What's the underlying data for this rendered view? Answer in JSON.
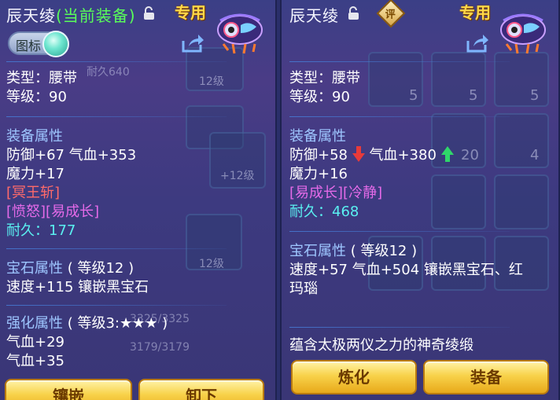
{
  "left": {
    "title_name": "辰天绫",
    "title_current": "(当前装备)",
    "special_tag": "专用",
    "icon_toggle_label": "图标",
    "type_line": "类型：腰带",
    "level_line": "等级：90",
    "attr_header": "装备属性",
    "attr_line1": "防御+67 气血+353",
    "attr_line2": "魔力+17",
    "skill": "[冥王斩]",
    "effects": "[愤怒][易成长]",
    "durability": "耐久：177",
    "gem_header": "宝石属性",
    "gem_level": "( 等级12 )",
    "gem_line": "速度+115 镶嵌黑宝石",
    "enh_header": "强化属性",
    "enh_level": "( 等级3:★★★ )",
    "enh_line1": "气血+29",
    "enh_line2": "气血+35",
    "bg_texts": {
      "durability_bg": "耐久640",
      "level_bg1": "12级",
      "level_bg2": "+12级",
      "level_bg3": "12级",
      "hp_bg1": "3325/3325",
      "hp_bg2": "3179/3179"
    },
    "buttons": [
      "镶嵌",
      "卸下"
    ]
  },
  "right": {
    "title_name": "辰天绫",
    "eval_badge": "评",
    "special_tag": "专用",
    "type_line": "类型：腰带",
    "level_line": "等级：90",
    "attr_header": "装备属性",
    "attr_def": "防御+58",
    "attr_hp": "气血+380",
    "attr_line2": "魔力+16",
    "effects": "[易成长][冷静]",
    "durability": "耐久：468",
    "gem_header": "宝石属性",
    "gem_level": "( 等级12 )",
    "gem_line1": "速度+57 气血+504 镶嵌黑宝石、红",
    "gem_line2": "玛瑙",
    "description": "蕴含太极两仪之力的神奇绫缎",
    "bg_numbers": [
      "5",
      "5",
      "5",
      "20",
      "4"
    ],
    "buttons": [
      "炼化",
      "装备"
    ]
  },
  "colors": {
    "gold": "#ffd84a",
    "green_current": "#59ff59",
    "header_blue": "#9ec6ff",
    "red_skill": "#ff6a6a",
    "purple_effect": "#e46ae8",
    "cyan_durability": "#5af0f0",
    "down_arrow": "#e83a3a",
    "up_arrow": "#2fd66a"
  }
}
